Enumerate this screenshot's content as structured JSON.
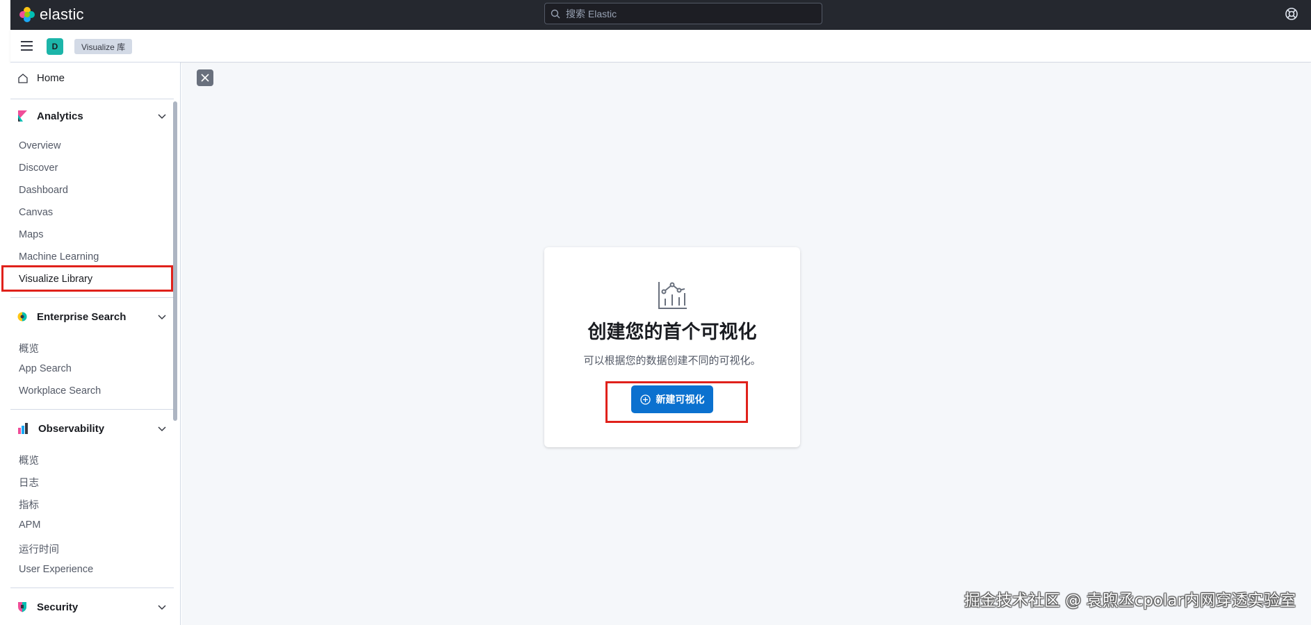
{
  "header": {
    "brand": "elastic",
    "search_placeholder": "搜索 Elastic"
  },
  "subbar": {
    "space_initial": "D",
    "breadcrumb": "Visualize 库"
  },
  "sidebar": {
    "home": "Home",
    "groups": [
      {
        "title": "Analytics",
        "items": [
          "Overview",
          "Discover",
          "Dashboard",
          "Canvas",
          "Maps",
          "Machine Learning",
          "Visualize Library"
        ]
      },
      {
        "title": "Enterprise Search",
        "items": [
          "概览",
          "App Search",
          "Workplace Search"
        ]
      },
      {
        "title": "Observability",
        "items": [
          "概览",
          "日志",
          "指标",
          "APM",
          "运行时间",
          "User Experience"
        ]
      },
      {
        "title": "Security",
        "items": []
      }
    ]
  },
  "main": {
    "title": "创建您的首个可视化",
    "description": "可以根据您的数据创建不同的可视化。",
    "create_button": "新建可视化"
  },
  "watermark": "掘金技术社区 @ 袁煦丞cpolar内网穿透实验室",
  "colors": {
    "header_bg": "#25282f",
    "primary": "#0b71cf",
    "space_badge": "#1cb5a9",
    "highlight": "#e0211b"
  }
}
